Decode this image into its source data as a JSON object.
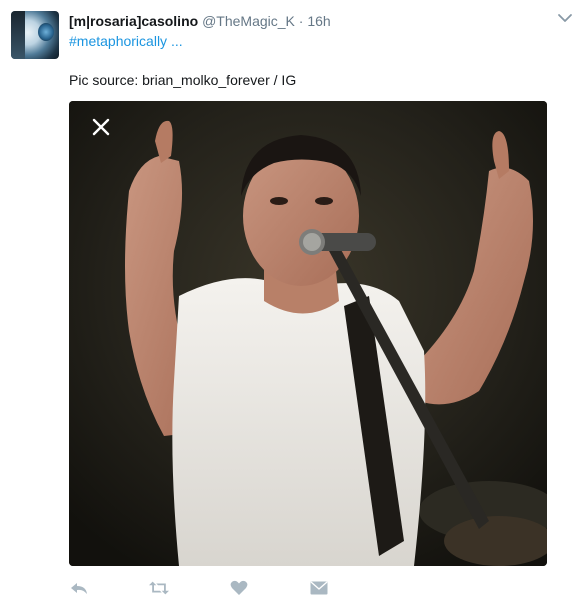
{
  "tweet": {
    "author": {
      "display_name": "[m|rosaria]casolino",
      "handle": "@TheMagic_K",
      "separator": "·",
      "timestamp": "16h",
      "avatar_icon": "avatar-image"
    },
    "hashtag": "#metaphorically ...",
    "caption": "Pic source: brian_molko_forever / IG",
    "media": {
      "close_icon": "close-icon"
    },
    "actions": [
      {
        "name": "reply",
        "icon": "reply-icon"
      },
      {
        "name": "retweet",
        "icon": "retweet-icon"
      },
      {
        "name": "like",
        "icon": "heart-icon"
      },
      {
        "name": "direct-message",
        "icon": "envelope-icon"
      }
    ],
    "menu_icon": "chevron-down-icon"
  },
  "colors": {
    "link": "#1b95e0",
    "secondary_text": "#657786",
    "action_icon": "#aab8c2"
  }
}
